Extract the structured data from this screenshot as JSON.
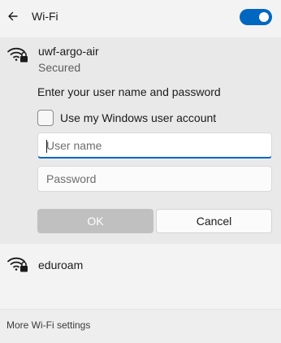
{
  "header": {
    "title": "Wi-Fi",
    "back_icon": "back-arrow-icon",
    "wifi_toggle_on": true,
    "accent_color": "#0067c0"
  },
  "networks": [
    {
      "name": "uwf-argo-air",
      "status": "Secured",
      "icon": "wifi-secured-icon",
      "expanded": true,
      "auth": {
        "prompt": "Enter your user name and password",
        "checkbox_label": "Use my Windows user account",
        "checkbox_checked": false,
        "username_placeholder": "User name",
        "username_value": "",
        "password_placeholder": "Password",
        "password_value": "",
        "ok_label": "OK",
        "cancel_label": "Cancel"
      }
    },
    {
      "name": "eduroam",
      "icon": "wifi-secured-icon"
    }
  ],
  "footer": {
    "more_settings_label": "More Wi-Fi settings"
  }
}
